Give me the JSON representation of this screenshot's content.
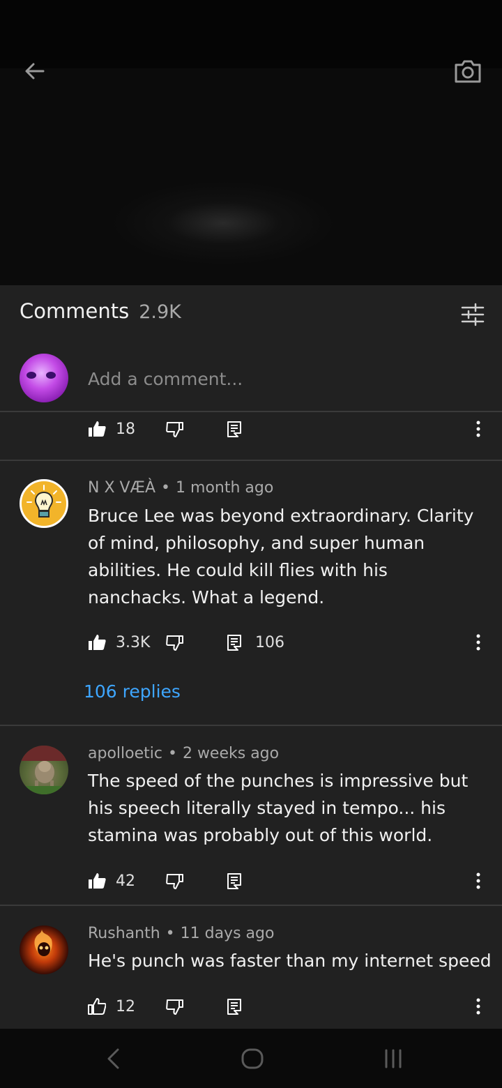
{
  "video": {
    "back_icon": "arrow-left-icon",
    "camera_icon": "camera-icon"
  },
  "comments_header": {
    "title": "Comments",
    "count": "2.9K",
    "filter_icon": "sliders-icon"
  },
  "add_comment": {
    "placeholder": "Add a comment..."
  },
  "partial_comment": {
    "likes": "18"
  },
  "comments": [
    {
      "author": "N X VÆÀ",
      "time": "1 month ago",
      "text": "Bruce Lee was beyond extraordinary. Clarity of mind, philosophy, and super human abilities. He could kill flies with his nanchacks. What a legend.",
      "likes": "3.3K",
      "reply_count": "106",
      "replies_link": "106 replies",
      "avatar": "lightbulb-avatar"
    },
    {
      "author": "apolloetic",
      "time": "2 weeks ago",
      "text": "The speed of the punches is impressive but his speech literally stayed in tempo... his stamina was probably out of this world.",
      "likes": "42",
      "avatar": "dog-photo-avatar"
    },
    {
      "author": "Rushanth",
      "time": "11 days ago",
      "text": "He's punch was faster than my internet speed",
      "likes": "12",
      "avatar": "fire-skull-avatar"
    }
  ],
  "colors": {
    "panel_bg": "#212121",
    "link": "#3ea6ff",
    "secondary_text": "#aaaaaa"
  },
  "navbar": {
    "back_icon": "nav-back-icon",
    "home_icon": "nav-home-icon",
    "recents_icon": "nav-recents-icon"
  }
}
